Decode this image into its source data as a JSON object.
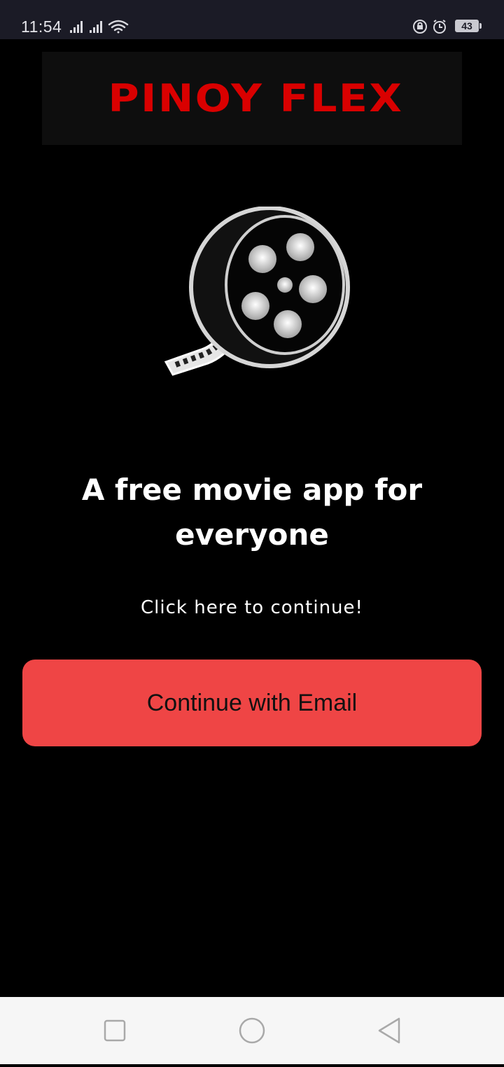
{
  "status_bar": {
    "time": "11:54",
    "battery": "43",
    "icons": [
      "signal-icon",
      "signal-icon",
      "wifi-icon",
      "lock-rotation-icon",
      "alarm-icon",
      "battery-icon"
    ]
  },
  "header": {
    "logo_text": "PINOY FLEX",
    "logo_color": "#d90000"
  },
  "hero": {
    "icon": "film-reel-icon",
    "headline": "A free movie app for everyone",
    "subtext": "Click here to continue!"
  },
  "actions": {
    "email_button_label": "Continue with Email",
    "email_button_color": "#ef4545"
  },
  "nav_bar": {
    "buttons": [
      "recents-square-icon",
      "home-circle-icon",
      "back-triangle-icon"
    ]
  }
}
